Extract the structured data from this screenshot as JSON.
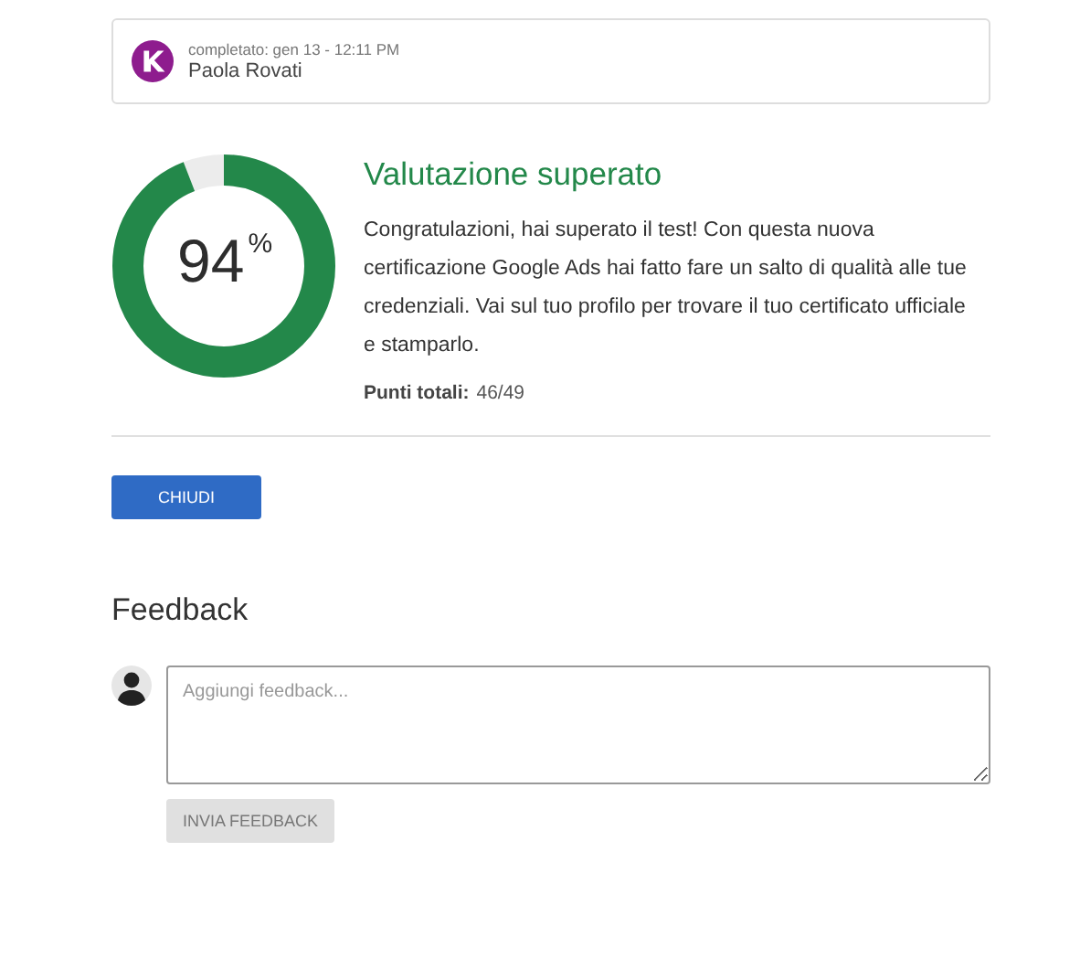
{
  "submission": {
    "completed": "completato: gen 13 - 12:11 PM",
    "name": "Paola Rovati"
  },
  "result": {
    "score": "94",
    "unit": "%",
    "title": "Valutazione superato",
    "message": "Congratulazioni, hai superato il test! Con questa nuova certificazione Google Ads hai fatto fare un salto di qualità alle tue credenziali. Vai sul tuo profilo per trovare il tuo certificato ufficiale e stamparlo.",
    "points_label": "Punti totali:",
    "points": "46/49"
  },
  "close_button": "CHIUDI",
  "feedback": {
    "heading": "Feedback",
    "placeholder": "Aggiungi feedback...",
    "button": "INVIA FEEDBACK",
    "button_disabled": true
  }
}
